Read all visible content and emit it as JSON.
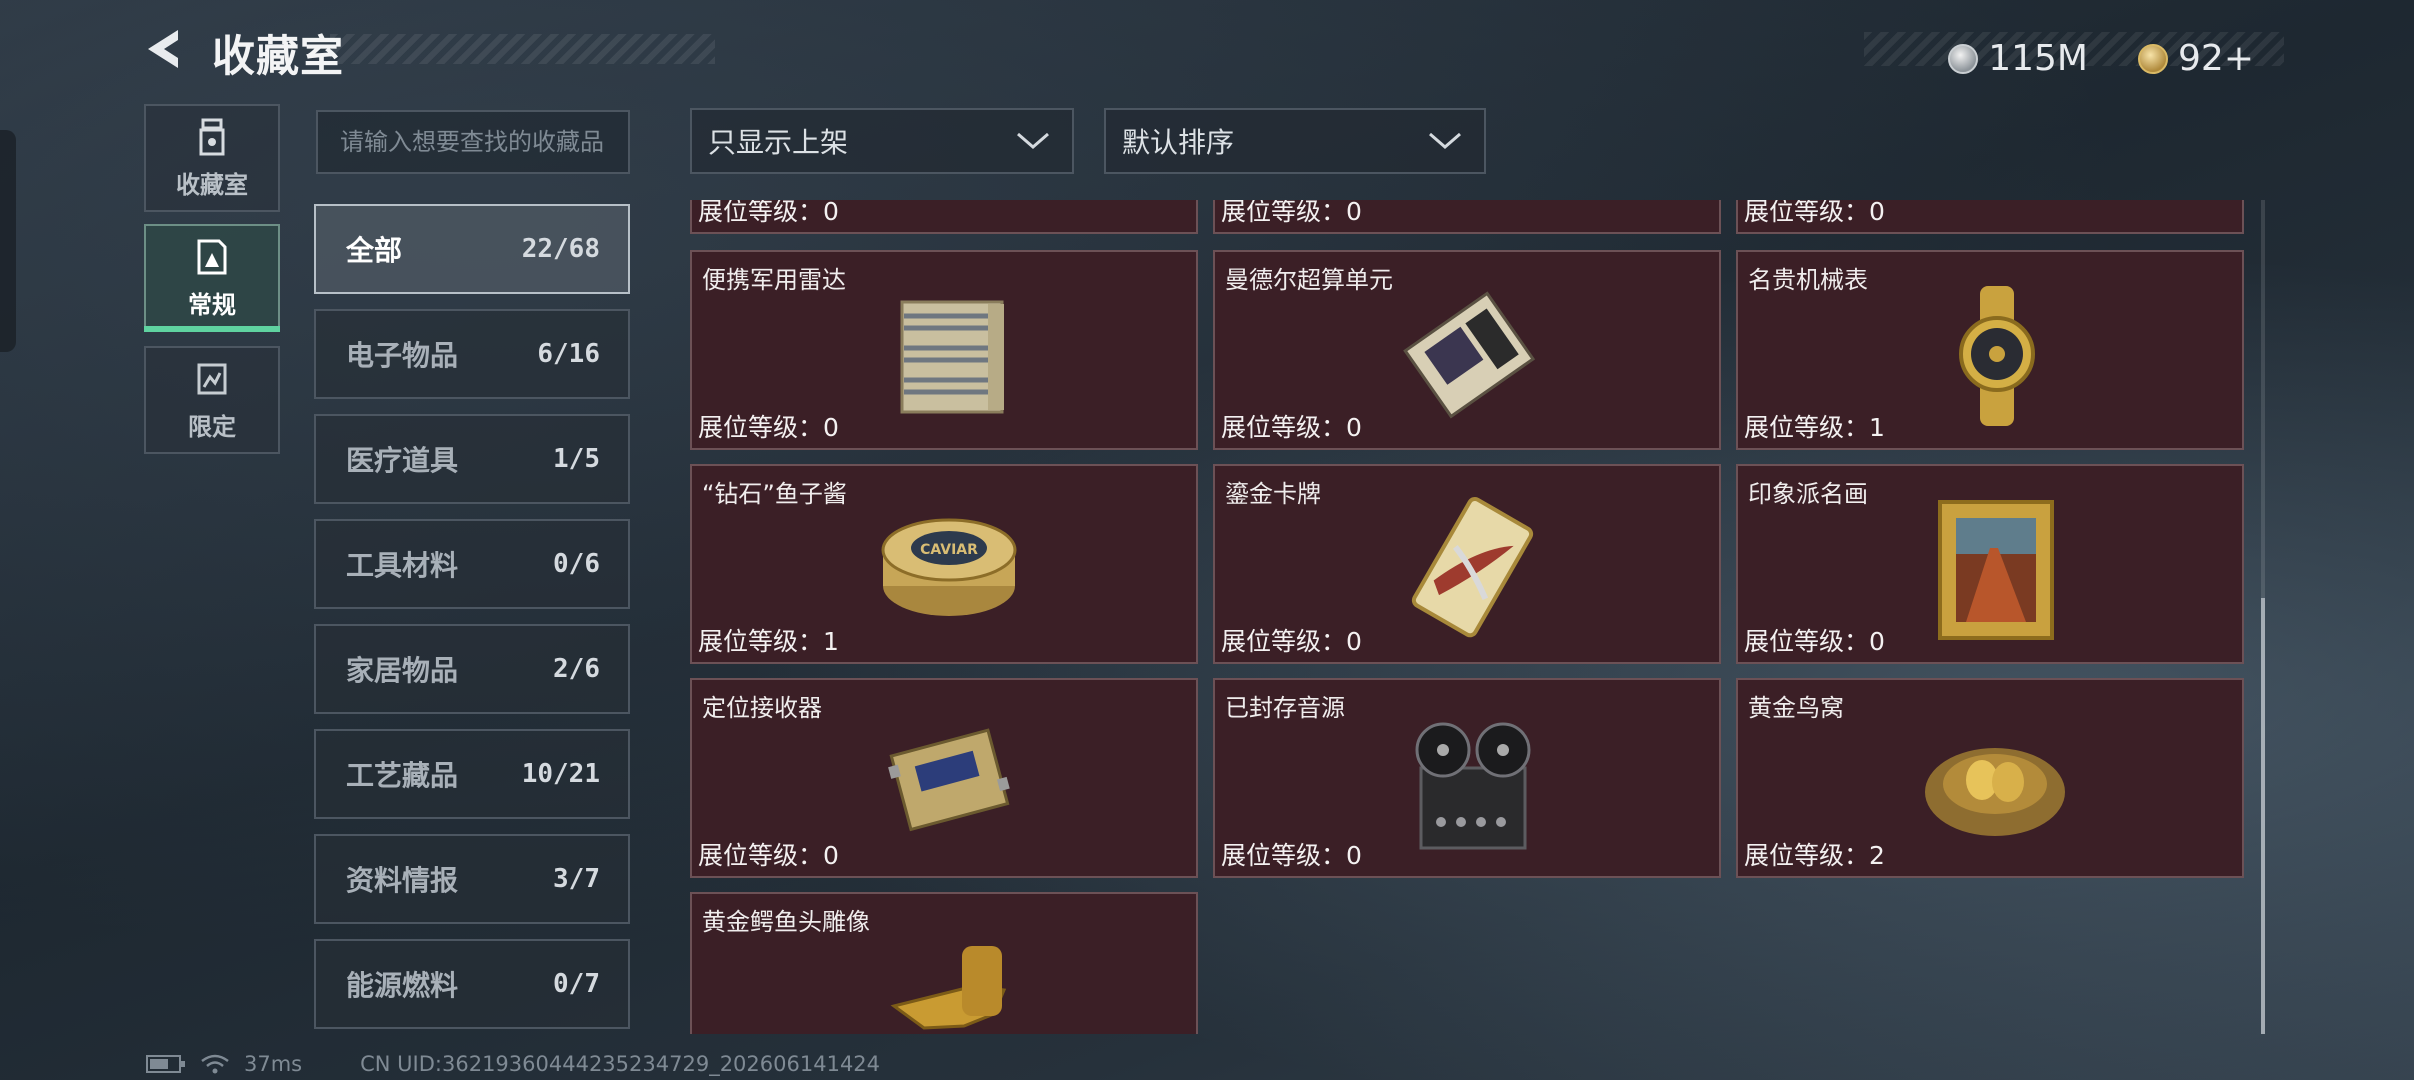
{
  "header": {
    "title": "收藏室",
    "currency": [
      {
        "icon": "silver-coin-icon",
        "value": "115M"
      },
      {
        "icon": "gold-coin-icon",
        "value": "92+"
      }
    ]
  },
  "tabs": [
    {
      "label": "收藏室",
      "icon": "collection-room-icon"
    },
    {
      "label": "常规",
      "icon": "regular-icon",
      "active": true
    },
    {
      "label": "限定",
      "icon": "limited-icon"
    }
  ],
  "search": {
    "placeholder": "请输入想要查找的收藏品"
  },
  "subcategories": [
    {
      "name": "全部",
      "count": "22/68",
      "active": true
    },
    {
      "name": "电子物品",
      "count": "6/16"
    },
    {
      "name": "医疗道具",
      "count": "1/5"
    },
    {
      "name": "工具材料",
      "count": "0/6"
    },
    {
      "name": "家居物品",
      "count": "2/6"
    },
    {
      "name": "工艺藏品",
      "count": "10/21"
    },
    {
      "name": "资料情报",
      "count": "3/7"
    },
    {
      "name": "能源燃料",
      "count": "0/7"
    }
  ],
  "filters": {
    "shelf": "只显示上架",
    "sort": "默认排序"
  },
  "items": [
    {
      "name": "",
      "level": "展位等级：0"
    },
    {
      "name": "",
      "level": "展位等级：0"
    },
    {
      "name": "",
      "level": "展位等级：0"
    },
    {
      "name": "便携军用雷达",
      "level": "展位等级：0",
      "art": "radar"
    },
    {
      "name": "曼德尔超算单元",
      "level": "展位等级：0",
      "art": "cpu"
    },
    {
      "name": "名贵机械表",
      "level": "展位等级：1",
      "art": "watch"
    },
    {
      "name": "“钻石”鱼子酱",
      "level": "展位等级：1",
      "art": "caviar"
    },
    {
      "name": "鎏金卡牌",
      "level": "展位等级：0",
      "art": "card"
    },
    {
      "name": "印象派名画",
      "level": "展位等级：0",
      "art": "painting"
    },
    {
      "name": "定位接收器",
      "level": "展位等级：0",
      "art": "receiver"
    },
    {
      "name": "已封存音源",
      "level": "展位等级：0",
      "art": "reel"
    },
    {
      "name": "黄金鸟窝",
      "level": "展位等级：2",
      "art": "nest"
    },
    {
      "name": "黄金鳄鱼头雕像",
      "level": "",
      "art": "croc"
    }
  ],
  "caviar_label": "CAVIAR",
  "footer": {
    "ping": "37ms",
    "uid": "CN UID:362193604442352347​29_202606141424"
  }
}
